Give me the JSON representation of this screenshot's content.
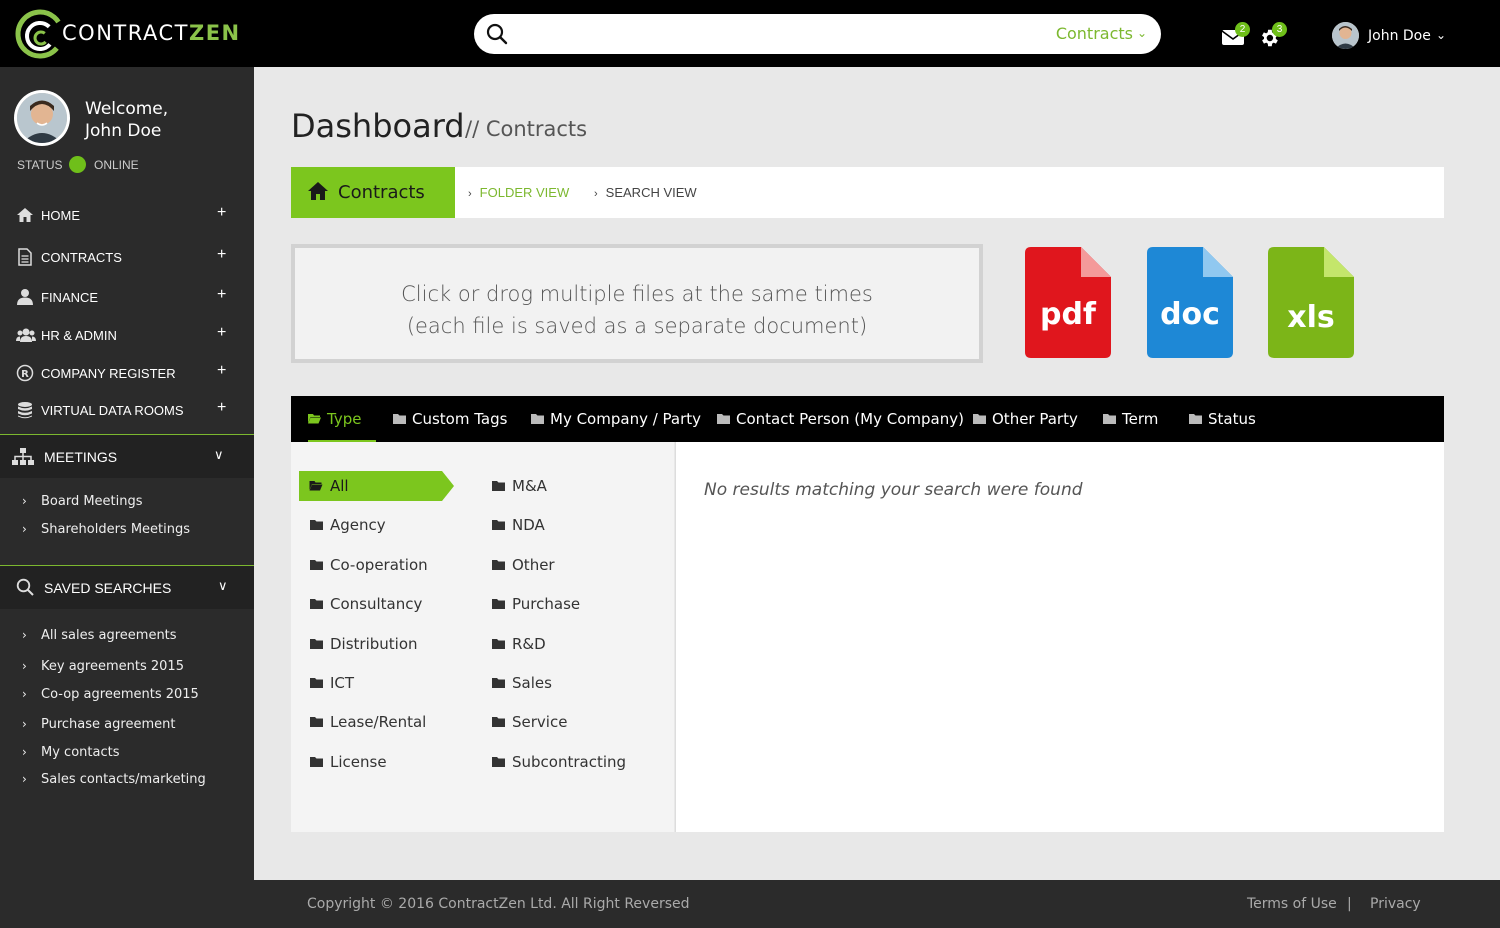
{
  "brand": {
    "name_part1": "CONTRACT",
    "name_part2": "ZEN"
  },
  "header": {
    "search_placeholder": "",
    "search_scope": "Contracts",
    "messages_count": "2",
    "settings_count": "3",
    "user_name": "John Doe"
  },
  "sidebar": {
    "welcome_line1": "Welcome,",
    "welcome_line2": "John Doe",
    "status_label": "STATUS",
    "status_value": "ONLINE",
    "nav": [
      {
        "label": "HOME",
        "icon": "home-icon"
      },
      {
        "label": "CONTRACTS",
        "icon": "document-icon"
      },
      {
        "label": "FINANCE",
        "icon": "user-icon"
      },
      {
        "label": "HR  & ADMIN",
        "icon": "users-icon"
      },
      {
        "label": "COMPANY REGISTER",
        "icon": "registered-icon"
      },
      {
        "label": "VIRTUAL DATA ROOMS",
        "icon": "database-icon"
      }
    ],
    "meetings": {
      "title": "MEETINGS",
      "items": [
        "Board Meetings",
        "Shareholders Meetings"
      ]
    },
    "saved_searches": {
      "title": "SAVED SEARCHES",
      "items": [
        "All sales agreements",
        "Key agreements 2015",
        "Co-op agreements 2015",
        "Purchase agreement",
        "My contacts",
        "Sales contacts/marketing"
      ]
    }
  },
  "main": {
    "title": "Dashboard",
    "crumb": "// Contracts",
    "tabs": {
      "active": "Contracts",
      "folder_view": "FOLDER VIEW",
      "search_view": "SEARCH VIEW"
    },
    "dropzone": {
      "line1": "Click or drog multiple files at the same times",
      "line2": "(each file is saved as a separate document)"
    },
    "file_types": [
      {
        "label": "pdf",
        "color": "#e0161d",
        "fold": "#f49a9a"
      },
      {
        "label": "doc",
        "color": "#1e88d6",
        "fold": "#90c8f0"
      },
      {
        "label": "xls",
        "color": "#7cb518",
        "fold": "#c4e66b"
      }
    ],
    "filters": [
      "Type",
      "Custom Tags",
      "My Company / Party",
      "Contact Person (My Company)",
      "Other Party",
      "Term",
      "Status"
    ],
    "types_col1": [
      "All",
      "Agency",
      "Co-operation",
      "Consultancy",
      "Distribution",
      "ICT",
      "Lease/Rental",
      "License"
    ],
    "types_col2": [
      "M&A",
      "NDA",
      "Other",
      "Purchase",
      "R&D",
      "Sales",
      "Service",
      "Subcontracting"
    ],
    "no_results": "No results matching your search were found"
  },
  "footer": {
    "copyright": "Copyright © 2016 ContractZen Ltd. All Right Reversed",
    "terms": "Terms of Use",
    "separator": "|",
    "privacy": "Privacy"
  },
  "colors": {
    "accent": "#7cc61e",
    "topbar": "#000000",
    "sidebar": "#2b2b2b"
  }
}
